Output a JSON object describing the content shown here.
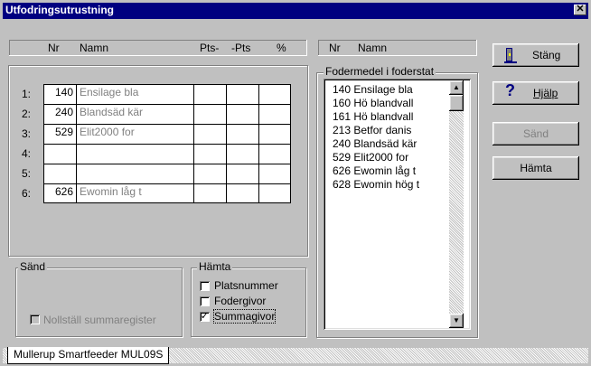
{
  "window": {
    "title": "Utfodringsutrustning",
    "close_symbol": "✕"
  },
  "table_header": {
    "nr": "Nr",
    "namn": "Namn",
    "pts_plus": "Pts-",
    "pts_minus": "-Pts",
    "percent": "%"
  },
  "rows": [
    {
      "label": "1:",
      "nr": "140",
      "namn": "Ensilage bla"
    },
    {
      "label": "2:",
      "nr": "240",
      "namn": "Blandsäd kär"
    },
    {
      "label": "3:",
      "nr": "529",
      "namn": "Elit2000 for"
    },
    {
      "label": "4:",
      "nr": "",
      "namn": ""
    },
    {
      "label": "5:",
      "nr": "",
      "namn": ""
    },
    {
      "label": "6:",
      "nr": "626",
      "namn": "Ewomin låg t"
    }
  ],
  "list_header": {
    "nr": "Nr",
    "namn": "Namn"
  },
  "fodermedel": {
    "label": "Fodermedel i foderstat",
    "items": [
      "140 Ensilage bla",
      "160 Hö blandvall",
      "161 Hö blandvall",
      "213 Betfor danis",
      "240 Blandsäd kär",
      "529 Elit2000 for",
      "626 Ewomin låg t",
      "628 Ewomin hög t"
    ]
  },
  "sand_group": {
    "label": "Sänd",
    "reset_label": "Nollställ summaregister",
    "reset_checked": false
  },
  "hamta_group": {
    "label": "Hämta",
    "platsnummer": "Platsnummer",
    "platsnummer_checked": false,
    "fodergivor": "Fodergivor",
    "fodergivor_checked": false,
    "summagivor": "Summagivor",
    "summagivor_checked": true
  },
  "buttons": {
    "stang": "Stäng",
    "hjalp": "Hjälp",
    "sand": "Sänd",
    "hamta": "Hämta"
  },
  "tab": {
    "label": "Mullerup Smartfeeder MUL09S"
  },
  "colors": {
    "titlebar": "#000080",
    "face": "#c0c0c0",
    "disabled_text": "#808080"
  }
}
